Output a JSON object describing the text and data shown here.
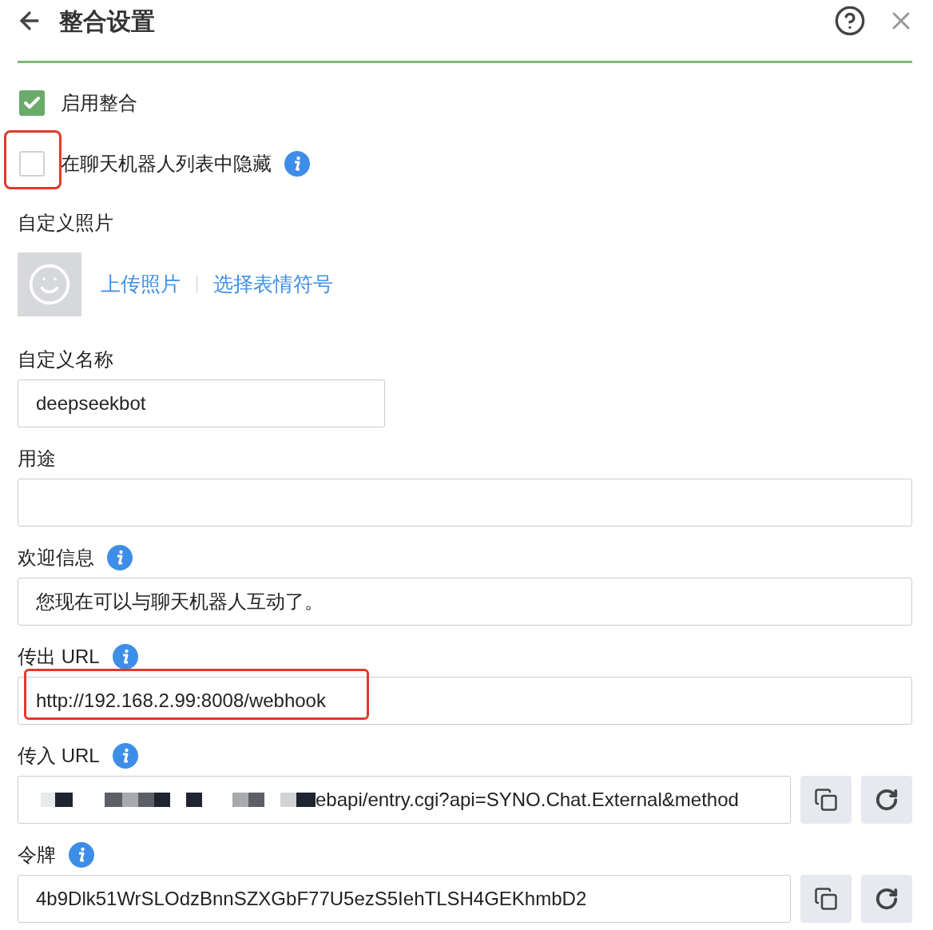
{
  "header": {
    "title": "整合设置"
  },
  "options": [
    {
      "label": "启用整合",
      "checked": true,
      "highlighted": false,
      "info": false
    },
    {
      "label": "在聊天机器人列表中隐藏",
      "checked": false,
      "highlighted": true,
      "info": true
    }
  ],
  "photo": {
    "label": "自定义照片",
    "links": [
      "上传照片",
      "选择表情符号"
    ]
  },
  "fields": [
    {
      "label": "自定义名称",
      "value": "deepseekbot",
      "info": false,
      "wide": false,
      "highlighted": false,
      "kind": "text"
    },
    {
      "label": "用途",
      "info": false,
      "wide": true,
      "highlighted": false,
      "kind": "text"
    },
    {
      "label": "欢迎信息",
      "value": "您现在可以与聊天机器人互动了。",
      "info": true,
      "wide": true,
      "highlighted": false,
      "kind": "text"
    },
    {
      "label": "传出 URL",
      "value": "http://192.168.2.99:8008/webhook",
      "info": true,
      "wide": true,
      "highlighted": true,
      "kind": "text"
    },
    {
      "label": "传入 URL",
      "value": "ebapi/entry.cgi?api=SYNO.Chat.External&method",
      "info": true,
      "wide": true,
      "highlighted": false,
      "kind": "redacted"
    },
    {
      "label": "令牌",
      "value": "4b9Dlk51WrSLOdzBnnSZXGbF77U5ezS5IehTLSH4GEKhmbD2",
      "info": true,
      "wide": true,
      "highlighted": false,
      "kind": "token"
    }
  ]
}
